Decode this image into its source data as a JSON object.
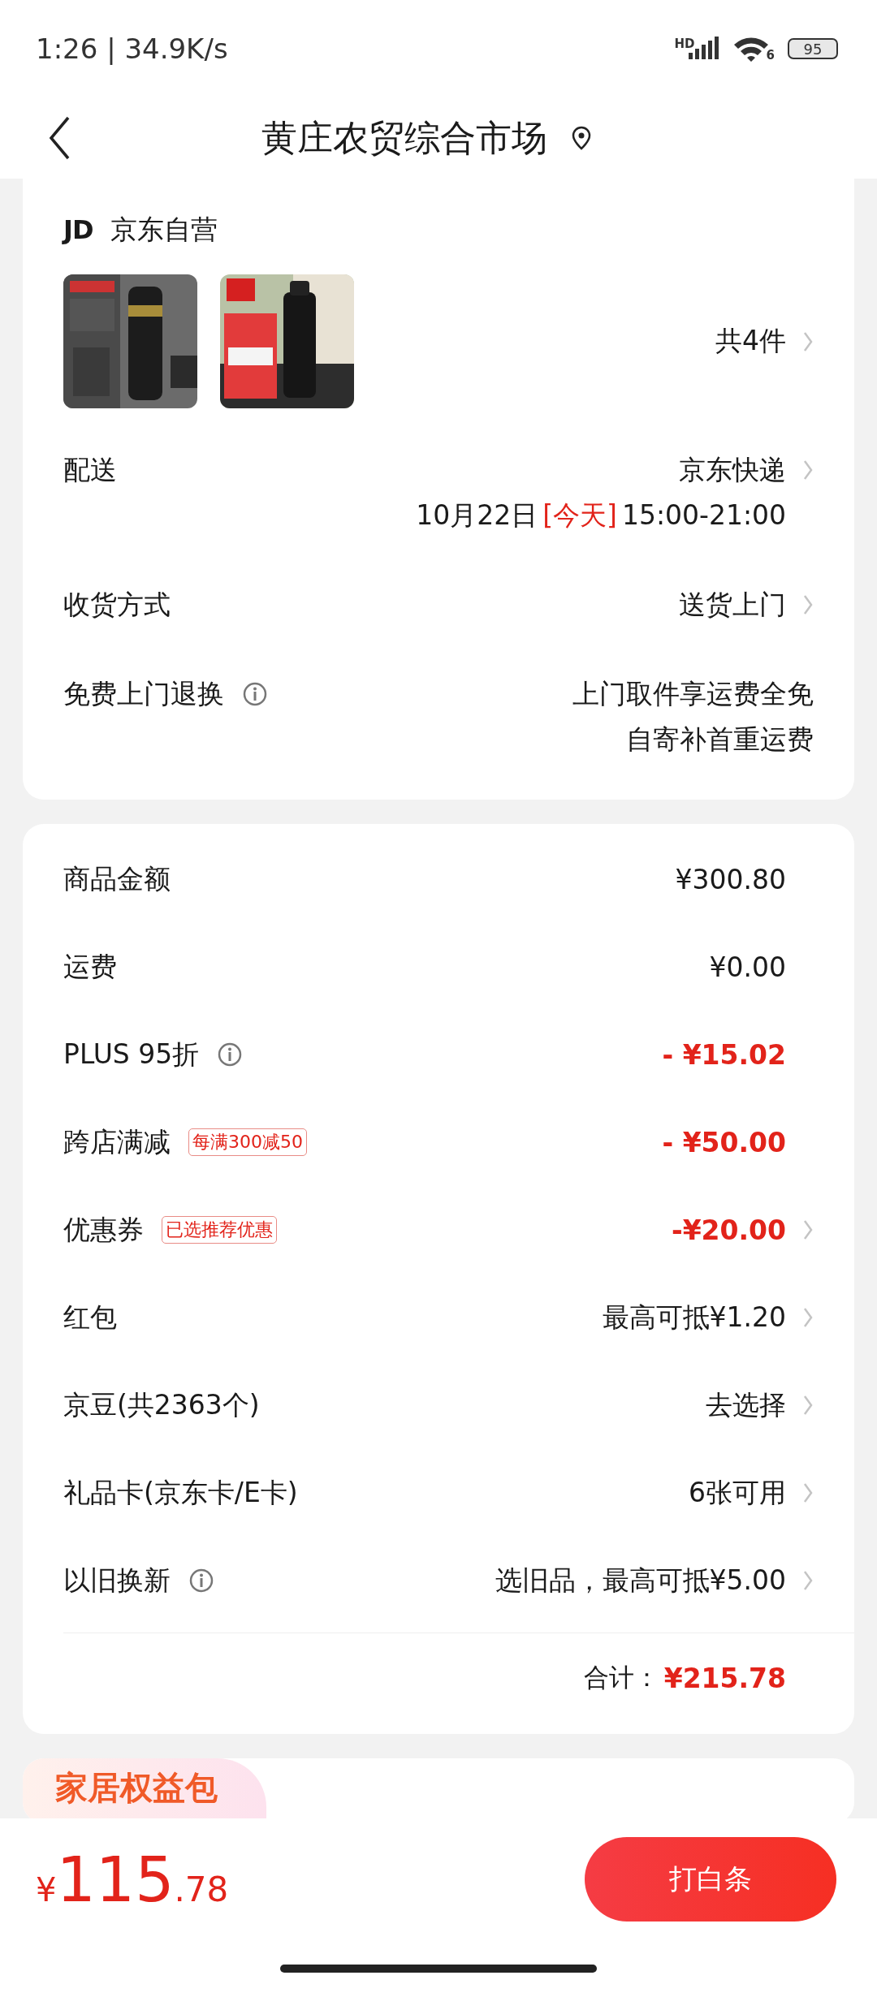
{
  "status_bar": {
    "time": "1:26 | 34.9K/s",
    "network": "HD",
    "wifi": "6",
    "battery": "95"
  },
  "header": {
    "title": "黄庄农贸综合市场"
  },
  "order_card": {
    "store_logo": "JD",
    "store_name": "京东自营",
    "count": "共4件",
    "rows": [
      {
        "label": "配送",
        "info": false,
        "lines": [
          "京东快递"
        ],
        "arrow": true,
        "schedule": {
          "date": "10月22日",
          "highlight": "[今天]",
          "time": "15:00-21:00"
        }
      },
      {
        "label": "收货方式",
        "info": false,
        "lines": [
          "送货上门"
        ],
        "arrow": true
      },
      {
        "label": "免费上门退换",
        "info": true,
        "lines": [
          "上门取件享运费全免",
          "自寄补首重运费"
        ],
        "arrow": false
      }
    ]
  },
  "price_card": {
    "rows": [
      {
        "label": "商品金额",
        "info": false,
        "value": "¥300.80",
        "highlight": false,
        "arrow": false
      },
      {
        "label": "运费",
        "info": false,
        "value": "¥0.00",
        "highlight": false,
        "arrow": false
      },
      {
        "label": "PLUS 95折",
        "info": true,
        "value": "- ¥15.02",
        "highlight": true,
        "arrow": false
      },
      {
        "label": "跨店满减",
        "info": false,
        "tag": "每满300减50",
        "value": "- ¥50.00",
        "highlight": true,
        "arrow": false
      },
      {
        "label": "优惠券",
        "info": false,
        "tag": "已选推荐优惠",
        "value": "-¥20.00",
        "highlight": true,
        "arrow": true
      },
      {
        "label": "红包",
        "info": false,
        "value": "最高可抵¥1.20",
        "highlight": false,
        "arrow": true
      },
      {
        "label": "京豆(共2363个)",
        "info": false,
        "value": "去选择",
        "highlight": false,
        "arrow": true
      },
      {
        "label": "礼品卡(京东卡/E卡)",
        "info": false,
        "value": "6张可用",
        "highlight": false,
        "arrow": true
      },
      {
        "label": "以旧换新",
        "info": true,
        "value": "选旧品，最高可抵¥5.00",
        "highlight": false,
        "arrow": true
      }
    ],
    "total_label": "合计：",
    "total_value": "¥215.78"
  },
  "promo_card": {
    "title": "家居权益包"
  },
  "bottom_bar": {
    "currency": "¥",
    "price_integer": "115",
    "price_decimal": ".78",
    "button": "打白条"
  }
}
